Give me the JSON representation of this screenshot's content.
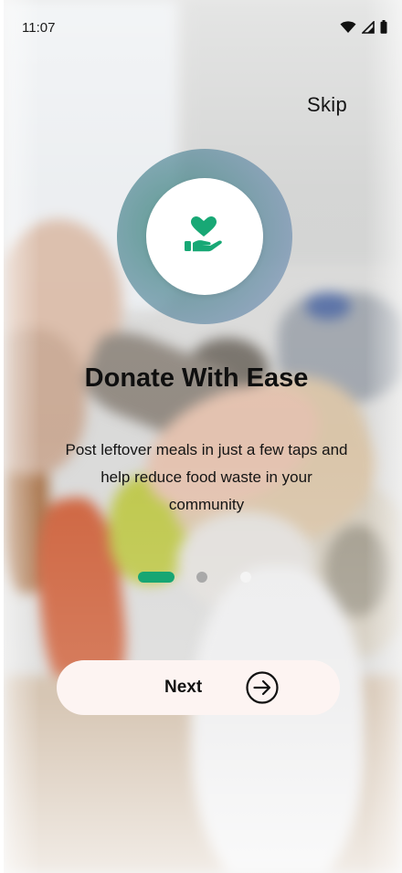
{
  "status_bar": {
    "time": "11:07",
    "icons": [
      "wifi-icon",
      "signal-icon",
      "battery-icon"
    ]
  },
  "header": {
    "skip_label": "Skip"
  },
  "onboarding": {
    "icon": "heart-in-hand-icon",
    "title": "Donate With Ease",
    "description": "Post leftover meals in just a few taps and help reduce food waste in your community",
    "page_index": 1,
    "page_count": 3
  },
  "actions": {
    "next_label": "Next",
    "next_icon": "arrow-right-circle-icon"
  },
  "colors": {
    "accent": "#17a673",
    "button_bg": "#fdf4f2",
    "dot_inactive": "#a9a9a9"
  }
}
